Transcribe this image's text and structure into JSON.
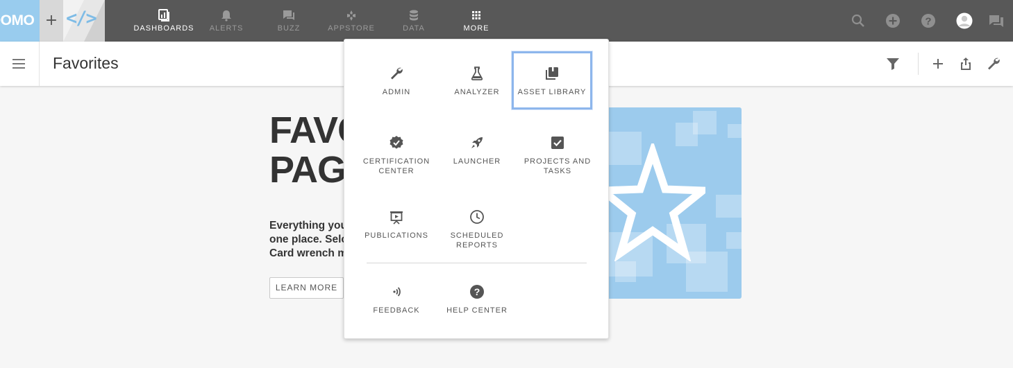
{
  "topbar": {
    "logo_text": "DOMO",
    "dev_logo_text": "</>",
    "plus": "+",
    "nav": [
      {
        "label": "DASHBOARDS",
        "icon": "dashboards-icon",
        "active": true
      },
      {
        "label": "ALERTS",
        "icon": "bell-icon",
        "active": false
      },
      {
        "label": "BUZZ",
        "icon": "chat-icon",
        "active": false
      },
      {
        "label": "APPSTORE",
        "icon": "appstore-icon",
        "active": false
      },
      {
        "label": "DATA",
        "icon": "database-icon",
        "active": false
      },
      {
        "label": "MORE",
        "icon": "grid-icon",
        "active": true
      }
    ],
    "right_icons": [
      "search-icon",
      "add-circle-icon",
      "help-icon",
      "avatar-icon",
      "buzz-chat-icon"
    ]
  },
  "subbar": {
    "title": "Favorites",
    "icons": [
      "filter-icon",
      "plus-icon",
      "share-icon",
      "wrench-icon"
    ]
  },
  "hero": {
    "title_line1": "FAVC",
    "title_line2": "PAG",
    "text_line1": "Everything you",
    "text_line2": "one place. Selc",
    "text_line3": "Card wrench m",
    "button": "LEARN MORE"
  },
  "more_menu": {
    "items": [
      {
        "label": "ADMIN",
        "icon": "wrench-icon"
      },
      {
        "label": "ANALYZER",
        "icon": "flask-icon"
      },
      {
        "label": "ASSET LIBRARY",
        "icon": "library-icon",
        "highlighted": true
      },
      {
        "label": "CERTIFICATION CENTER",
        "icon": "certified-badge-icon"
      },
      {
        "label": "LAUNCHER",
        "icon": "rocket-icon"
      },
      {
        "label": "PROJECTS AND TASKS",
        "icon": "checkbox-icon"
      },
      {
        "label": "PUBLICATIONS",
        "icon": "presentation-icon"
      },
      {
        "label": "SCHEDULED REPORTS",
        "icon": "clock-icon"
      },
      {
        "label": "FEEDBACK",
        "icon": "feedback-icon"
      },
      {
        "label": "HELP CENTER",
        "icon": "help-circle-icon"
      }
    ]
  },
  "colors": {
    "topbar": "#585858",
    "logo_bg": "#99ccee",
    "highlight": "#8db6ec",
    "hero_img": "#9ccbed"
  }
}
